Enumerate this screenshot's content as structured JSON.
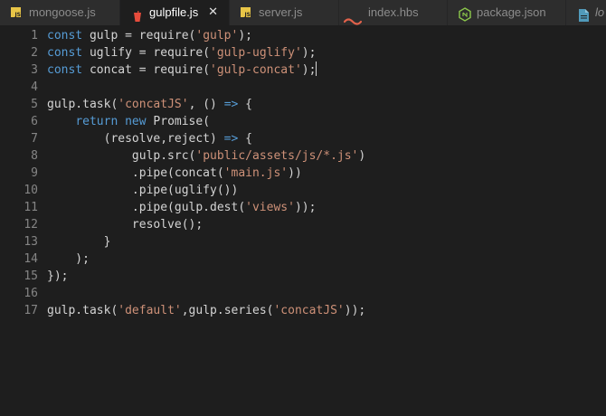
{
  "tabs": [
    {
      "label": "mongoose.js",
      "icon": "js-file-icon",
      "active": false
    },
    {
      "label": "gulpfile.js",
      "icon": "gulp-icon",
      "active": true,
      "close": "✕"
    },
    {
      "label": "server.js",
      "icon": "js-file-icon",
      "active": false
    },
    {
      "label": "index.hbs",
      "icon": "handlebars-icon",
      "active": false
    },
    {
      "label": "package.json",
      "icon": "node-icon",
      "active": false
    },
    {
      "label": "lo",
      "icon": "document-icon",
      "active": false
    }
  ],
  "editor": {
    "line_numbers": [
      "1",
      "2",
      "3",
      "4",
      "5",
      "6",
      "7",
      "8",
      "9",
      "10",
      "11",
      "12",
      "13",
      "14",
      "15",
      "16",
      "17"
    ],
    "lines": [
      [
        [
          "kw",
          "const"
        ],
        [
          "t",
          " gulp = require("
        ],
        [
          "str",
          "'gulp'"
        ],
        [
          "t",
          ");"
        ]
      ],
      [
        [
          "kw",
          "const"
        ],
        [
          "t",
          " uglify = require("
        ],
        [
          "str",
          "'gulp-uglify'"
        ],
        [
          "t",
          ");"
        ]
      ],
      [
        [
          "kw",
          "const"
        ],
        [
          "t",
          " concat = require("
        ],
        [
          "str",
          "'gulp-concat'"
        ],
        [
          "t",
          ");"
        ]
      ],
      [],
      [
        [
          "t",
          "gulp.task("
        ],
        [
          "str",
          "'concatJS'"
        ],
        [
          "t",
          ", () "
        ],
        [
          "kw",
          "=>"
        ],
        [
          "t",
          " {"
        ]
      ],
      [
        [
          "t",
          "    "
        ],
        [
          "kw",
          "return"
        ],
        [
          "t",
          " "
        ],
        [
          "kw",
          "new"
        ],
        [
          "t",
          " Promise("
        ]
      ],
      [
        [
          "t",
          "        (resolve,reject) "
        ],
        [
          "kw",
          "=>"
        ],
        [
          "t",
          " {"
        ]
      ],
      [
        [
          "t",
          "            gulp.src("
        ],
        [
          "str",
          "'public/assets/js/*.js'"
        ],
        [
          "t",
          ")"
        ]
      ],
      [
        [
          "t",
          "            .pipe(concat("
        ],
        [
          "str",
          "'main.js'"
        ],
        [
          "t",
          "))"
        ]
      ],
      [
        [
          "t",
          "            .pipe(uglify())"
        ]
      ],
      [
        [
          "t",
          "            .pipe(gulp.dest("
        ],
        [
          "str",
          "'views'"
        ],
        [
          "t",
          "));"
        ]
      ],
      [
        [
          "t",
          "            resolve();"
        ]
      ],
      [
        [
          "t",
          "        }"
        ]
      ],
      [
        [
          "t",
          "    );"
        ]
      ],
      [
        [
          "t",
          "});"
        ]
      ],
      [],
      [
        [
          "t",
          "gulp.task("
        ],
        [
          "str",
          "'default'"
        ],
        [
          "t",
          ",gulp.series("
        ],
        [
          "str",
          "'concatJS'"
        ],
        [
          "t",
          "));"
        ]
      ]
    ],
    "cursor_line": 3
  },
  "colors": {
    "background": "#1e1e1e",
    "keyword": "#569cd6",
    "string": "#ce9178",
    "text": "#d4d4d4",
    "line_number": "#858585",
    "tab_inactive": "#2d2d2d",
    "gulp_red": "#e74c3c"
  }
}
